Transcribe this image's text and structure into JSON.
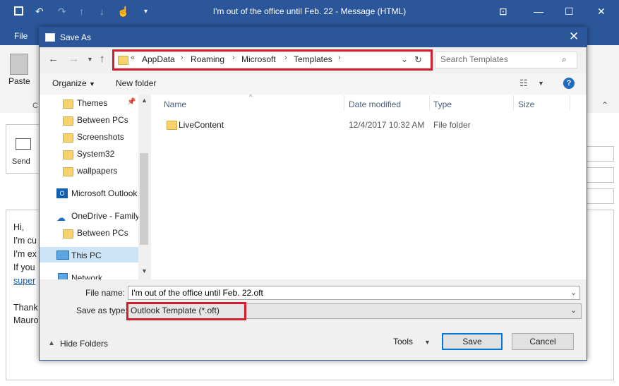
{
  "outlook": {
    "title": "I'm out of the office until Feb. 22  -  Message (HTML)",
    "file_tab": "File",
    "paste_label": "Paste",
    "send_label": "Send",
    "clipboard_fragment": "C",
    "body_lines": [
      "Hi,",
      "I'm cu",
      "I'm ex",
      "If you"
    ],
    "body_link": "super",
    "body_thanks": "Thank",
    "body_name": "Mauro"
  },
  "dialog": {
    "title": "Save As",
    "breadcrumb": [
      "AppData",
      "Roaming",
      "Microsoft",
      "Templates"
    ],
    "breadcrumb_overflow": "«",
    "search_placeholder": "Search Templates",
    "organize_label": "Organize",
    "new_folder_label": "New folder",
    "help_label": "?",
    "nav_items": [
      {
        "label": "Themes",
        "icon": "folder-icon"
      },
      {
        "label": "Between PCs",
        "icon": "folder-icon"
      },
      {
        "label": "Screenshots",
        "icon": "folder-icon"
      },
      {
        "label": "System32",
        "icon": "folder-icon"
      },
      {
        "label": "wallpapers",
        "icon": "folder-icon"
      },
      {
        "label": "Microsoft Outlook",
        "icon": "outlook-icon"
      },
      {
        "label": "OneDrive - Family",
        "icon": "onedrive-icon"
      },
      {
        "label": "Between PCs",
        "icon": "folder-icon"
      },
      {
        "label": "This PC",
        "icon": "computer-icon"
      },
      {
        "label": "Network",
        "icon": "network-icon"
      }
    ],
    "columns": [
      "Name",
      "Date modified",
      "Type",
      "Size"
    ],
    "files": [
      {
        "name": "LiveContent",
        "date": "12/4/2017 10:32 AM",
        "type": "File folder",
        "size": ""
      }
    ],
    "file_name_label": "File name:",
    "file_name_value": "I'm out of the office until Feb. 22.oft",
    "save_type_label": "Save as type:",
    "save_type_value": "Outlook Template (*.oft)",
    "hide_folders_label": "Hide Folders",
    "tools_label": "Tools",
    "save_label": "Save",
    "cancel_label": "Cancel"
  },
  "colors": {
    "outlook_blue": "#2b579a",
    "highlight_red": "#d0202e",
    "selection": "#cce4f7",
    "folder": "#f7d36d"
  }
}
